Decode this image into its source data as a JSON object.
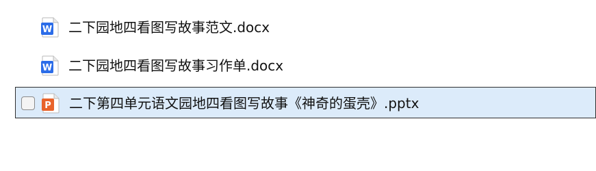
{
  "files": [
    {
      "name": "二下园地四看图写故事范文.docx",
      "icon": "word-doc-icon",
      "icon_letter": "W",
      "icon_color": "#2b6ce8",
      "selected": false
    },
    {
      "name": "二下园地四看图写故事习作单.docx",
      "icon": "word-doc-icon",
      "icon_letter": "W",
      "icon_color": "#2b6ce8",
      "selected": false
    },
    {
      "name": "二下第四单元语文园地四看图写故事《神奇的蛋壳》.pptx",
      "icon": "powerpoint-icon",
      "icon_letter": "P",
      "icon_color": "#e8632b",
      "selected": true
    }
  ],
  "colors": {
    "selection_background": "#dcebfa",
    "selection_border": "#2e2e2e",
    "text": "#111111"
  }
}
